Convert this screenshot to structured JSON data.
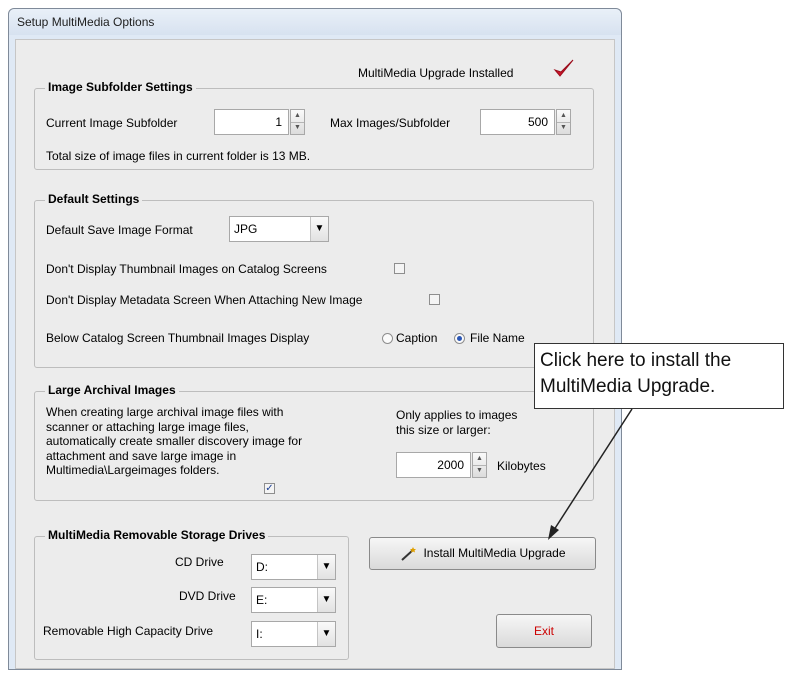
{
  "window": {
    "title": "Setup MultiMedia Options"
  },
  "upgrade_status": {
    "label": "MultiMedia Upgrade Installed",
    "icon": "red-checkmark-icon"
  },
  "image_subfolder": {
    "legend": "Image Subfolder Settings",
    "current_label": "Current Image Subfolder",
    "current_value": "1",
    "max_label": "Max Images/Subfolder",
    "max_value": "500",
    "size_text": "Total size of image files in current folder is 13 MB."
  },
  "default_settings": {
    "legend": "Default Settings",
    "format_label": "Default Save Image Format",
    "format_value": "JPG",
    "no_thumbnails_label": "Don't Display Thumbnail Images on Catalog Screens",
    "no_thumbnails_checked": false,
    "no_metadata_label": "Don't Display Metadata Screen When Attaching New Image",
    "no_metadata_checked": false,
    "below_label": "Below Catalog Screen Thumbnail Images Display",
    "option_caption": "Caption",
    "option_filename": "File Name",
    "selected_option": "File Name"
  },
  "large_archival": {
    "legend": "Large Archival Images",
    "desc_line1": "When creating large archival image files with",
    "desc_line2": "scanner or attaching large image files,",
    "desc_line3": "automatically create smaller discovery image for",
    "desc_line4": "attachment and save large image in",
    "desc_line5": "Multimedia\\Largeimages folders.",
    "checked": true,
    "applies_line1": "Only applies to images",
    "applies_line2": "this size or larger:",
    "size_value": "2000",
    "size_unit": "Kilobytes"
  },
  "removable_drives": {
    "legend": "MultiMedia Removable Storage Drives",
    "cd_label": "CD Drive",
    "cd_value": "D:",
    "dvd_label": "DVD Drive",
    "dvd_value": "E:",
    "rhc_label": "Removable High Capacity Drive",
    "rhc_value": "I:"
  },
  "buttons": {
    "install_label": "Install MultiMedia Upgrade",
    "exit_label": "Exit",
    "exit_color": "#cc0000"
  },
  "callout": {
    "line1": "Click here to install the",
    "line2": "MultiMedia Upgrade."
  }
}
